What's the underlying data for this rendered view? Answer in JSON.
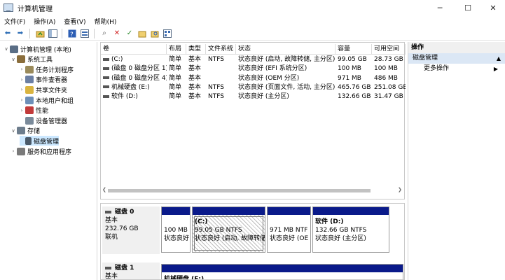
{
  "window": {
    "title": "计算机管理",
    "controls": [
      "─",
      "☐",
      "✕"
    ]
  },
  "menu": [
    "文件(F)",
    "操作(A)",
    "查看(V)",
    "帮助(H)"
  ],
  "tree": [
    {
      "label": "计算机管理 (本地)",
      "level": 0,
      "arrow": "∨",
      "icon": "computer-management-icon",
      "color": "#5a6e86"
    },
    {
      "label": "系统工具",
      "level": 1,
      "arrow": "∨",
      "icon": "system-tools-icon",
      "color": "#8a6d3b"
    },
    {
      "label": "任务计划程序",
      "level": 2,
      "arrow": "›",
      "icon": "task-scheduler-icon",
      "color": "#9a8a5a"
    },
    {
      "label": "事件查看器",
      "level": 2,
      "arrow": "›",
      "icon": "event-viewer-icon",
      "color": "#6b7fa3"
    },
    {
      "label": "共享文件夹",
      "level": 2,
      "arrow": "›",
      "icon": "shared-folders-icon",
      "color": "#d9b440"
    },
    {
      "label": "本地用户和组",
      "level": 2,
      "arrow": "›",
      "icon": "local-users-icon",
      "color": "#6d8fb8"
    },
    {
      "label": "性能",
      "level": 2,
      "arrow": "›",
      "icon": "performance-icon",
      "color": "#c23a3a"
    },
    {
      "label": "设备管理器",
      "level": 2,
      "arrow": "",
      "icon": "device-manager-icon",
      "color": "#7a8a9a"
    },
    {
      "label": "存储",
      "level": 1,
      "arrow": "∨",
      "icon": "storage-icon",
      "color": "#6d7d8d"
    },
    {
      "label": "磁盘管理",
      "level": 2,
      "arrow": "",
      "icon": "disk-management-icon",
      "color": "#4a5a6a",
      "selected": true
    },
    {
      "label": "服务和应用程序",
      "level": 1,
      "arrow": "›",
      "icon": "services-apps-icon",
      "color": "#7a7a7a"
    }
  ],
  "columns": [
    "卷",
    "布局",
    "类型",
    "文件系统",
    "状态",
    "容量",
    "可用空间"
  ],
  "volumes": [
    [
      "(C:)",
      "简单",
      "基本",
      "NTFS",
      "状态良好 (启动, 故障转储, 主分区)",
      "99.05 GB",
      "28.73 GB"
    ],
    [
      "(磁盘 0 磁盘分区 1)",
      "简单",
      "基本",
      "",
      "状态良好 (EFI 系统分区)",
      "100 MB",
      "100 MB"
    ],
    [
      "(磁盘 0 磁盘分区 4)",
      "简单",
      "基本",
      "",
      "状态良好 (OEM 分区)",
      "971 MB",
      "486 MB"
    ],
    [
      "机械硬盘 (E:)",
      "简单",
      "基本",
      "NTFS",
      "状态良好 (页面文件, 活动, 主分区)",
      "465.76 GB",
      "251.08 GB"
    ],
    [
      "软件 (D:)",
      "简单",
      "基本",
      "NTFS",
      "状态良好 (主分区)",
      "132.66 GB",
      "31.47 GB"
    ]
  ],
  "disks": [
    {
      "name": "磁盘 0",
      "type": "基本",
      "size": "232.76 GB",
      "status": "联机",
      "partitions": [
        {
          "title": "",
          "line1": "100 MB",
          "line2": "状态良好"
        },
        {
          "title": "(C:)",
          "line1": "99.05 GB NTFS",
          "line2": "状态良好 (启动, 故障转储",
          "hatched": true
        },
        {
          "title": "",
          "line1": "971 MB NTF",
          "line2": "状态良好 (OE"
        },
        {
          "title": "软件  (D:)",
          "line1": "132.66 GB NTFS",
          "line2": "状态良好 (主分区)"
        }
      ]
    },
    {
      "name": "磁盘 1",
      "type": "基本",
      "partitions": [
        {
          "title": "机械硬盘  (E:)"
        }
      ]
    }
  ],
  "actions": {
    "header": "操作",
    "section": "磁盘管理",
    "more": "更多操作"
  },
  "colors": {
    "selection": "#cce8ff",
    "partition_bar": "#0a1a8a",
    "action_section": "#dbe7f5"
  }
}
